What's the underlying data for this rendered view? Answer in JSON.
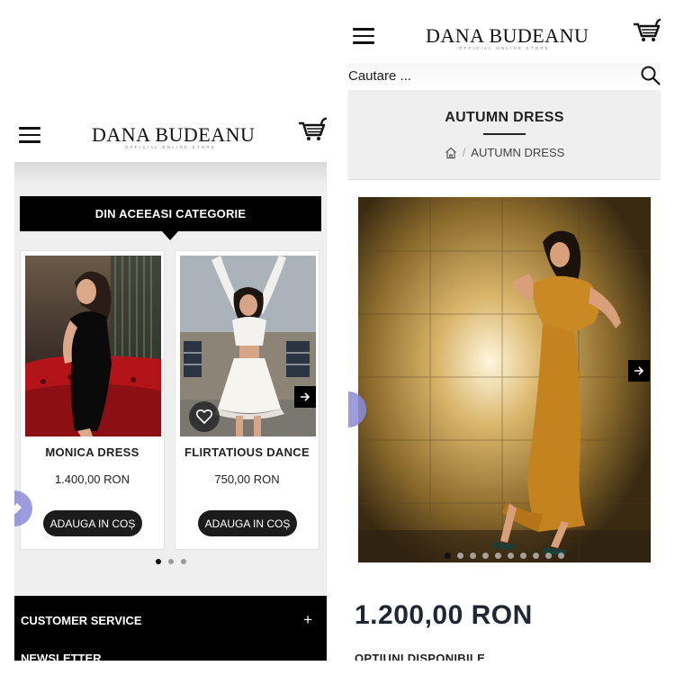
{
  "brand": {
    "name": "DANA BUDEANU",
    "tagline": "OFFICIAL ONLINE STORE"
  },
  "left": {
    "category_banner": "DIN ACEEASI CATEGORIE",
    "products": [
      {
        "name": "MONICA DRESS",
        "price": "1.400,00 RON",
        "button": "ADAUGA IN COȘ"
      },
      {
        "name": "FLIRTATIOUS DANCE",
        "price": "750,00 RON",
        "button": "ADAUGA IN COȘ"
      }
    ],
    "carousel_dots": {
      "count": 3,
      "active": 0
    },
    "footer": {
      "customer_service": "CUSTOMER SERVICE",
      "expand_symbol": "+",
      "newsletter": "NEWSLETTER"
    }
  },
  "right": {
    "search": {
      "placeholder": "Cautare ..."
    },
    "page_title": "AUTUMN DRESS",
    "breadcrumb": {
      "home_icon": "home-icon",
      "separator": "/",
      "current": "AUTUMN DRESS"
    },
    "slider_dots": {
      "count": 10,
      "active": 0
    },
    "price": "1.200,00 RON",
    "options_label": "OPTIUNI DISPONIBILE"
  },
  "colors": {
    "black": "#000000",
    "grey_bg": "#efefef",
    "dress_orange": "#c98a26",
    "dress_red": "#c8181e",
    "float_circle": "#8c8cd8"
  }
}
